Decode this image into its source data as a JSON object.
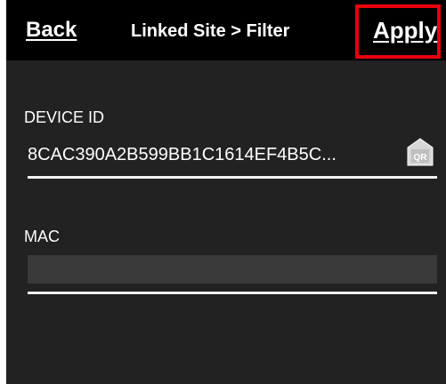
{
  "navbar": {
    "back_label": "Back",
    "title": "Linked Site > Filter",
    "apply_label": "Apply"
  },
  "highlight_color": "#e8000b",
  "fields": {
    "device_id": {
      "label": "DEVICE ID",
      "value": "8CAC390A2B599BB1C1614EF4B5C...",
      "qr_icon": "qr-scan-icon",
      "qr_text": "QR"
    },
    "mac": {
      "label": "MAC",
      "value": "",
      "placeholder": ""
    }
  }
}
